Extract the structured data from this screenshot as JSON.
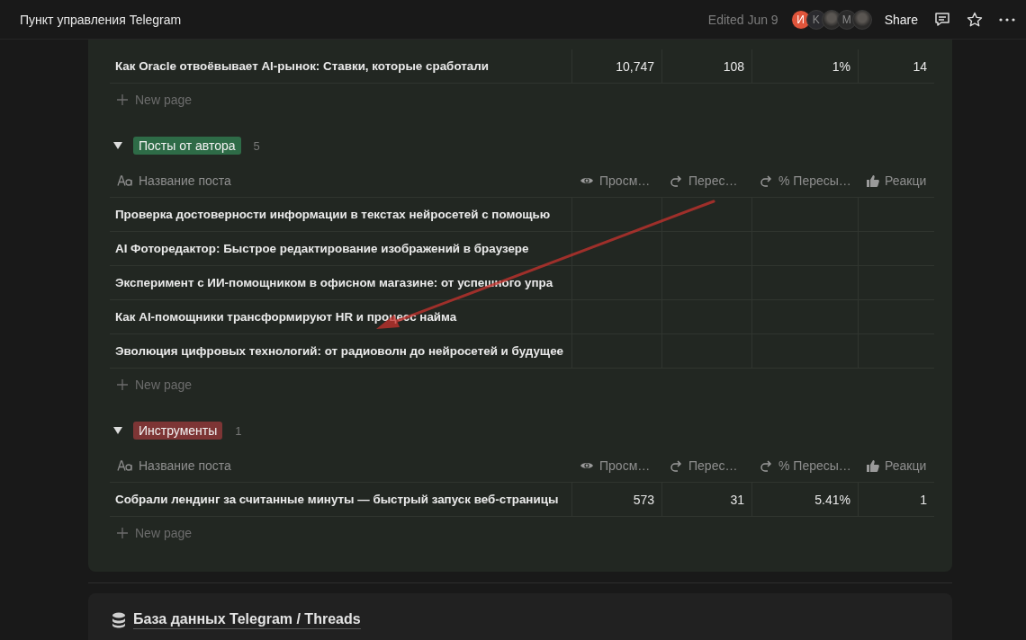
{
  "window": {
    "title": "Пункт управления Telegram"
  },
  "topbar": {
    "edited": "Edited Jun 9",
    "avatars": [
      {
        "kind": "letter",
        "letter": "И",
        "color": "#e0553b"
      },
      {
        "kind": "letter",
        "letter": "K",
        "color": "#2a2a2e"
      },
      {
        "kind": "photo"
      },
      {
        "kind": "letter",
        "letter": "M",
        "color": "#2a2a2a"
      },
      {
        "kind": "photo"
      }
    ],
    "share": "Share"
  },
  "board": {
    "groups": [
      {
        "rows": [
          {
            "title": "Как Oracle отвоёвывает AI-рынок: Ставки, которые сработали",
            "values": [
              "10,747",
              "108",
              "1%",
              "14"
            ]
          }
        ],
        "new_page": "New page"
      },
      {
        "tag": "Посты от автора",
        "color": "#2e6b47",
        "count": "5",
        "expanded": true,
        "columns": [
          {
            "kind": "text",
            "label": "Название поста"
          },
          {
            "kind": "eye",
            "label": "Просм…"
          },
          {
            "kind": "forward",
            "label": "Перес…"
          },
          {
            "kind": "forward",
            "label": "% Пересы…"
          },
          {
            "kind": "thumb",
            "label": "Реакци"
          }
        ],
        "rows": [
          {
            "title": "Проверка достоверности информации в текстах нейросетей с помощью"
          },
          {
            "title": "AI Фоторедактор: Быстрое редактирование изображений в браузере"
          },
          {
            "title": "Эксперимент с ИИ-помощником в офисном магазине: от успешного упра"
          },
          {
            "title": "Как AI-помощники трансформируют HR и процесс найма"
          },
          {
            "title": "Эволюция цифровых технологий: от радиоволн до нейросетей и будущее"
          }
        ],
        "new_page": "New page"
      },
      {
        "tag": "Инструменты",
        "color": "#7d3535",
        "count": "1",
        "expanded": true,
        "columns": [
          {
            "kind": "text",
            "label": "Название поста"
          },
          {
            "kind": "eye",
            "label": "Просм…"
          },
          {
            "kind": "forward",
            "label": "Перес…"
          },
          {
            "kind": "forward",
            "label": "% Пересы…"
          },
          {
            "kind": "thumb",
            "label": "Реакци"
          }
        ],
        "rows": [
          {
            "title": "Собрали лендинг за считанные минуты — быстрый запуск веб-страницы",
            "values": [
              "573",
              "31",
              "5.41%",
              "1"
            ]
          }
        ],
        "new_page": "New page"
      }
    ]
  },
  "database": {
    "title": "База данных Telegram / Threads"
  }
}
